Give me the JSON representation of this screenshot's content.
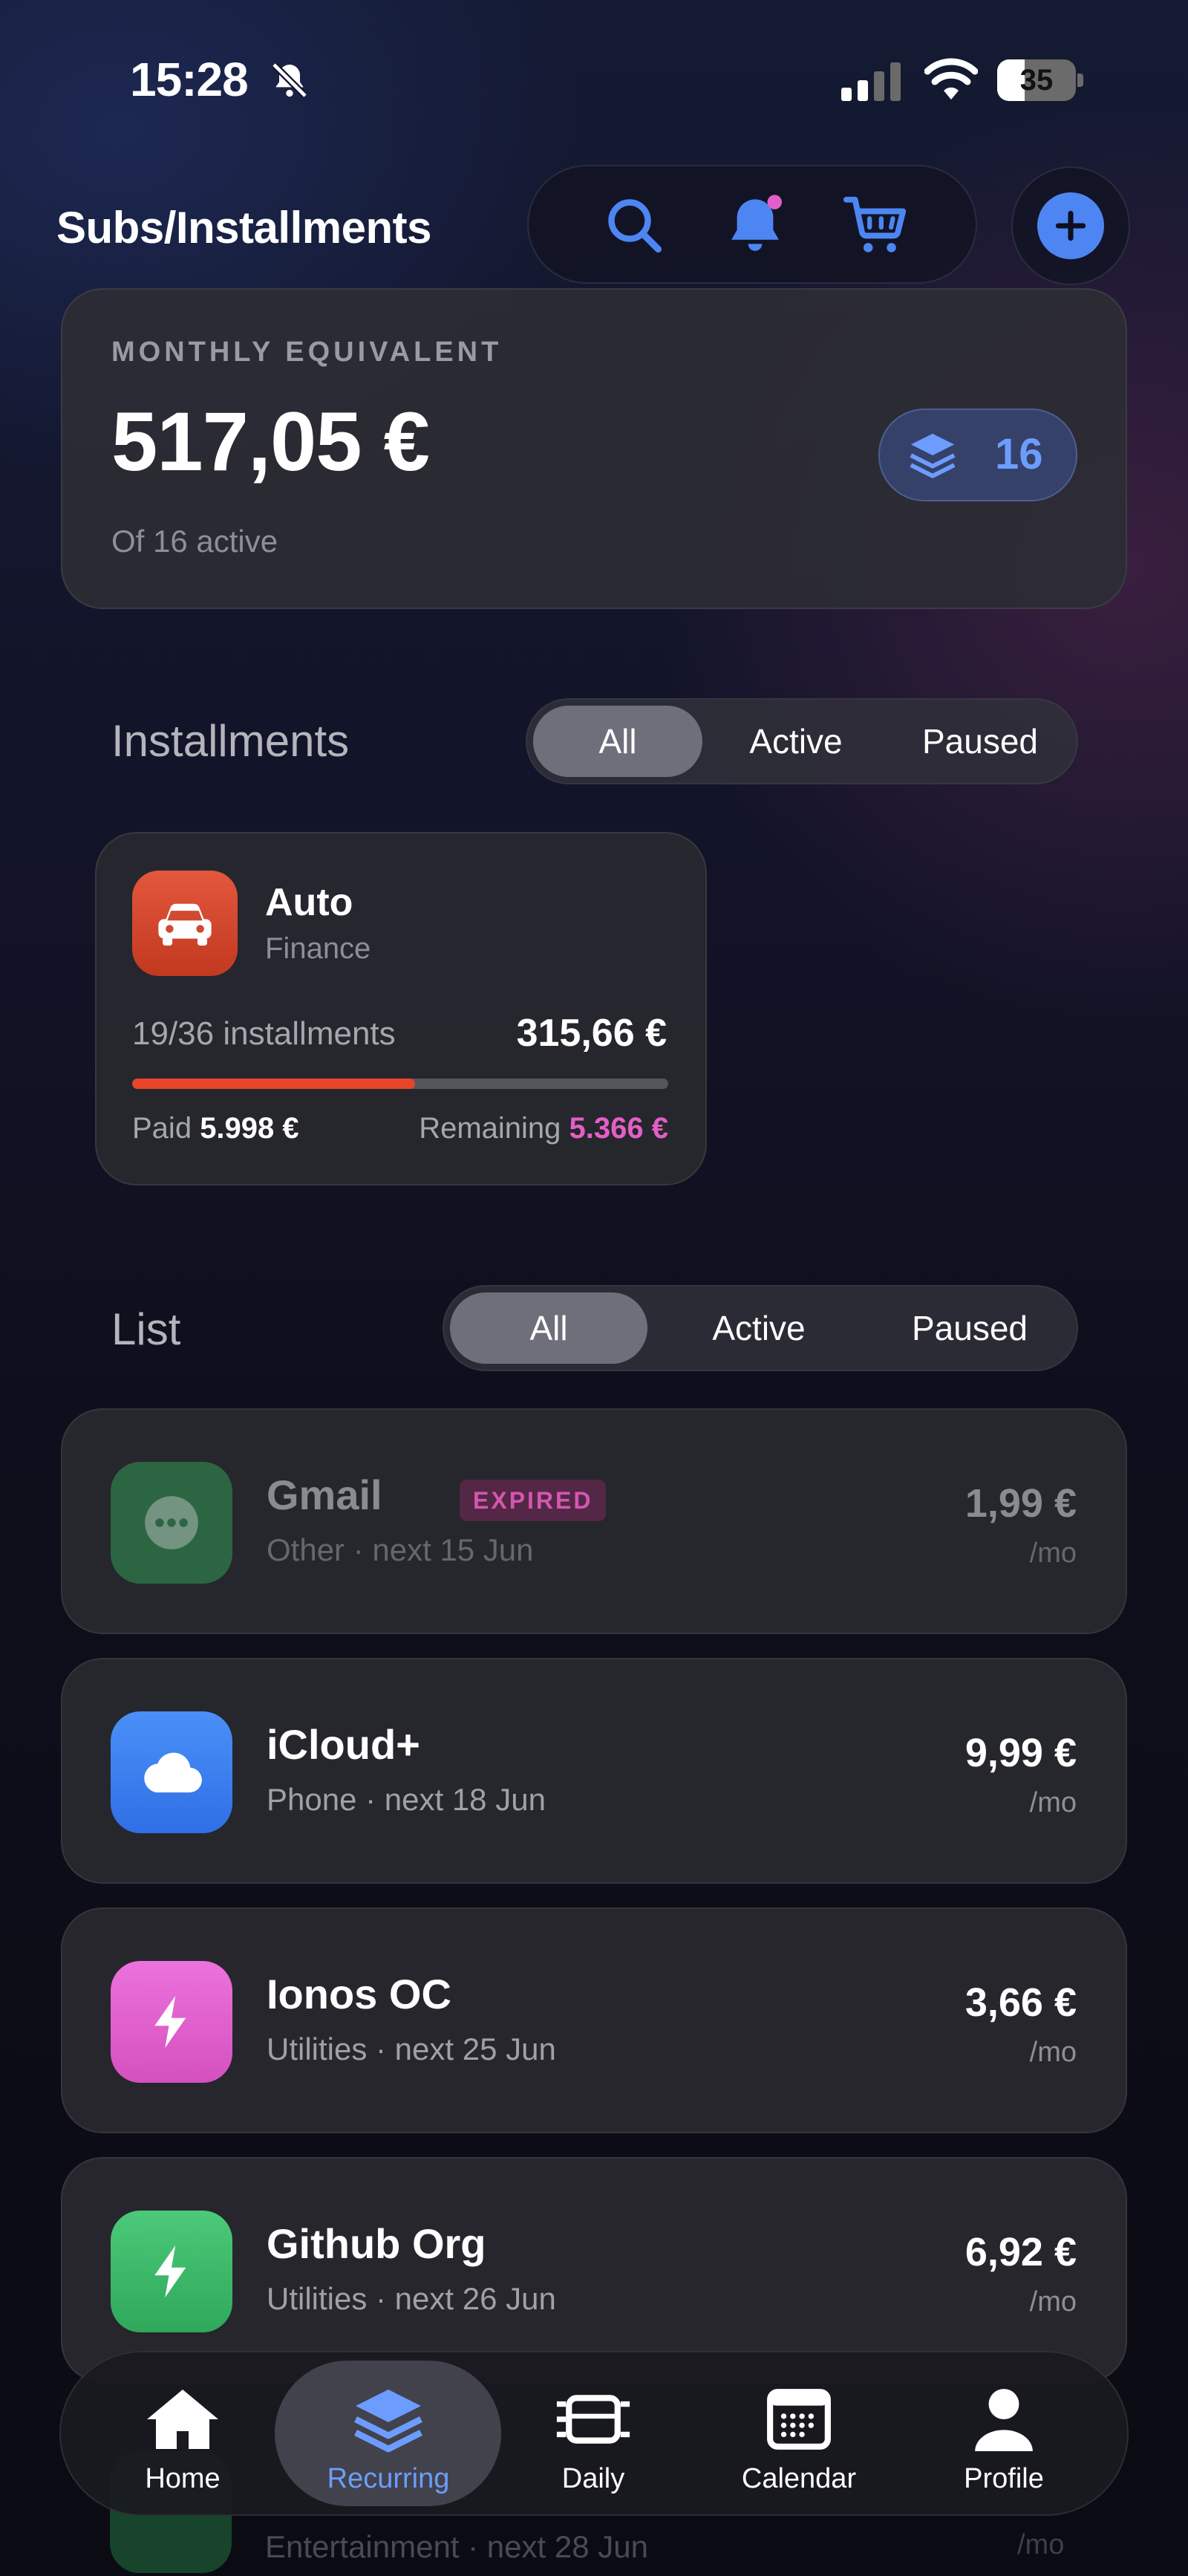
{
  "status_bar": {
    "time": "15:28",
    "battery": "35",
    "battery_level": 0.35
  },
  "header": {
    "title": "Subs/Installments",
    "actions": [
      "search-icon",
      "bell-icon",
      "cart-icon"
    ],
    "add_icon": "plus-icon"
  },
  "summary": {
    "label": "MONTHLY EQUIVALENT",
    "amount": "517,05 €",
    "subtitle": "Of 16 active",
    "badge_count": "16"
  },
  "installments": {
    "title": "Installments",
    "filters": [
      "All",
      "Active",
      "Paused"
    ],
    "selected_filter": "All",
    "items": [
      {
        "name": "Auto",
        "category": "Finance",
        "icon": "car-icon",
        "progress_text": "19/36 installments",
        "amount": "315,66 €",
        "progress": 0.5278,
        "paid_label": "Paid",
        "paid_value": "5.998 €",
        "remaining_label": "Remaining",
        "remaining_value": "5.366 €"
      }
    ]
  },
  "list": {
    "title": "List",
    "filters": [
      "All",
      "Active",
      "Paused"
    ],
    "selected_filter": "All",
    "items": [
      {
        "name": "Gmail",
        "badge": "EXPIRED",
        "meta": "Other · next 15 Jun",
        "price": "1,99 €",
        "per": "/mo",
        "icon": "more-dots-icon",
        "color": "#2f7a4a"
      },
      {
        "name": "iCloud+",
        "meta": "Phone · next 18 Jun",
        "price": "9,99 €",
        "per": "/mo",
        "icon": "cloud-icon",
        "color": "#3b7ff0"
      },
      {
        "name": "Ionos OC",
        "meta": "Utilities · next 25 Jun",
        "price": "3,66 €",
        "per": "/mo",
        "icon": "bolt-icon",
        "color": "#e05fcd"
      },
      {
        "name": "Github Org",
        "meta": "Utilities · next 26 Jun",
        "price": "6,92 €",
        "per": "/mo",
        "icon": "bolt-icon",
        "color": "#3bb866"
      },
      {
        "meta": "Entertainment · next 28 Jun",
        "per": "/mo",
        "icon": "music-note-icon",
        "color": "#1f6b3c"
      }
    ]
  },
  "tabbar": {
    "tabs": [
      {
        "label": "Home",
        "icon": "home-icon"
      },
      {
        "label": "Recurring",
        "icon": "layers-icon"
      },
      {
        "label": "Daily",
        "icon": "daily-icon"
      },
      {
        "label": "Calendar",
        "icon": "calendar-icon"
      },
      {
        "label": "Profile",
        "icon": "person-icon"
      }
    ],
    "active": "Recurring"
  },
  "colors": {
    "accent": "#4d86f2",
    "progress": "#e8442a",
    "remaining": "#e35fc7",
    "notification_dot": "#e35fc7"
  }
}
